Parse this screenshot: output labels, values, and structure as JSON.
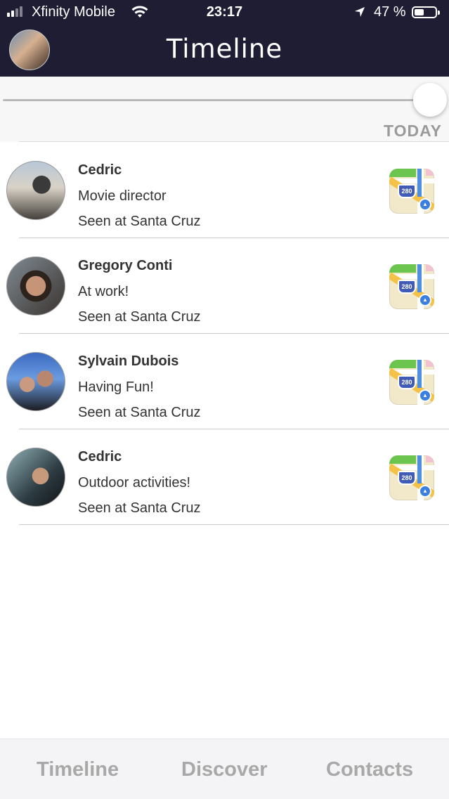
{
  "status_bar": {
    "carrier": "Xfinity Mobile",
    "time": "23:17",
    "battery_percent": "47 %",
    "battery_level": 0.47
  },
  "nav": {
    "title": "Timeline"
  },
  "timeline": {
    "period_label": "TODAY",
    "slider_position": 1.0
  },
  "entries": [
    {
      "name": "Cedric",
      "status": "Movie director",
      "seen": "Seen at Santa Cruz"
    },
    {
      "name": "Gregory Conti",
      "status": "At work!",
      "seen": "Seen at Santa Cruz"
    },
    {
      "name": "Sylvain Dubois",
      "status": "Having Fun!",
      "seen": "Seen at Santa Cruz"
    },
    {
      "name": "Cedric",
      "status": "Outdoor activities!",
      "seen": "Seen at Santa Cruz"
    }
  ],
  "map_icon": {
    "highway_number": "280"
  },
  "tabs": [
    {
      "label": "Timeline"
    },
    {
      "label": "Discover"
    },
    {
      "label": "Contacts"
    }
  ]
}
